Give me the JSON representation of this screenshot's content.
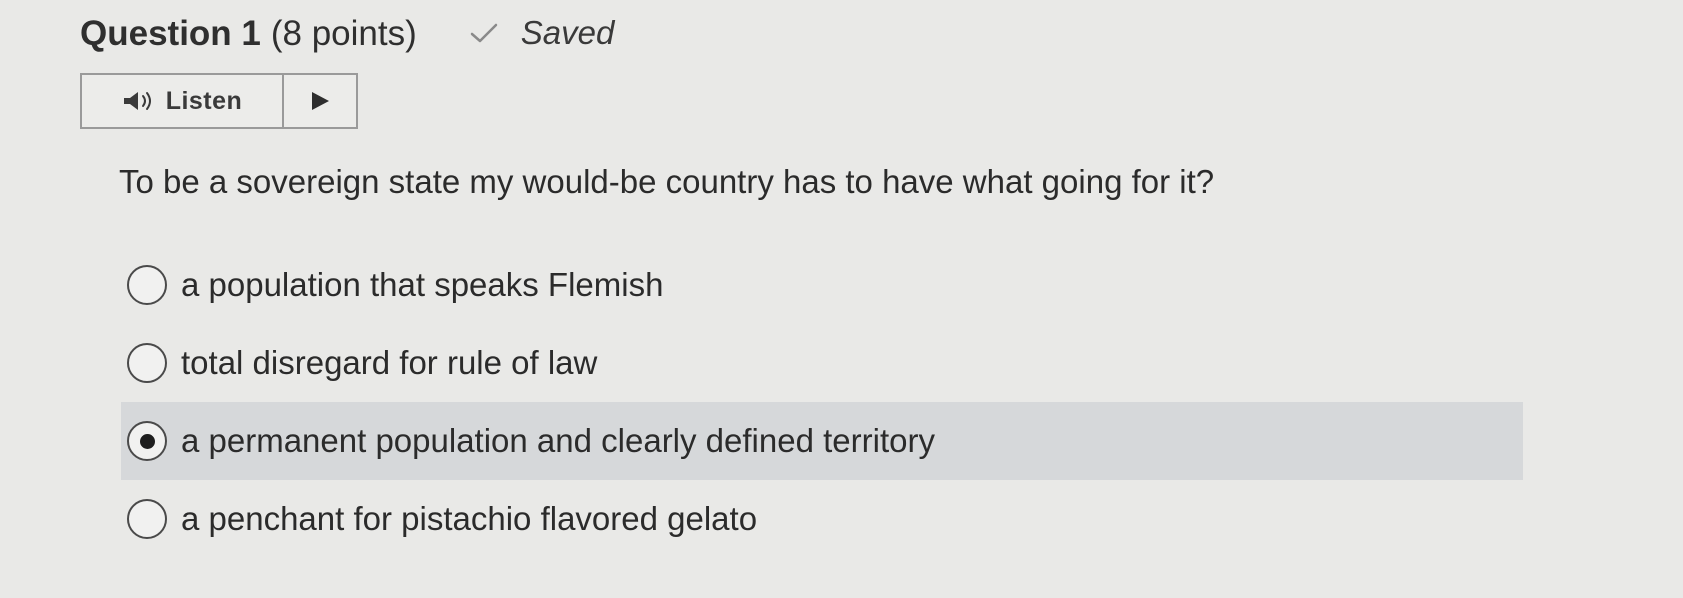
{
  "question": {
    "title": "Question 1",
    "points": "(8 points)",
    "status": "Saved",
    "status_icon": "check-icon"
  },
  "listen": {
    "label": "Listen",
    "speaker_icon": "speaker-icon",
    "play_icon": "play-icon"
  },
  "prompt": "To be a sovereign state my would-be country has to have what going for it?",
  "options": [
    {
      "label": "a population that speaks Flemish",
      "selected": false
    },
    {
      "label": "total disregard for rule of law",
      "selected": false
    },
    {
      "label": "a permanent population and clearly defined territory",
      "selected": true
    },
    {
      "label": "a penchant for pistachio flavored gelato",
      "selected": false
    }
  ],
  "colors": {
    "background": "#e9e9e7",
    "selected_row": "#d6d8da",
    "text": "#2b2b2b"
  }
}
